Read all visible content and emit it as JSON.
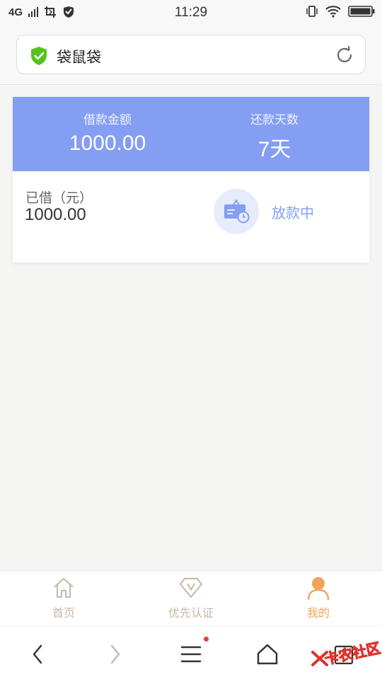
{
  "status_bar": {
    "network": "4G",
    "time": "11:29"
  },
  "url_bar": {
    "title": "袋鼠袋"
  },
  "loan_card": {
    "amount_label": "借款金额",
    "amount_value": "1000.00",
    "days_label": "还款天数",
    "days_value": "7天",
    "borrowed_label": "已借（元）",
    "borrowed_value": "1000.00",
    "status_text": "放款中"
  },
  "tabs": [
    {
      "label": "首页",
      "icon": "home-icon",
      "active": false
    },
    {
      "label": "优先认证",
      "icon": "diamond-v-icon",
      "active": false
    },
    {
      "label": "我的",
      "icon": "user-icon",
      "active": true
    }
  ],
  "browser_bar": {
    "tab_count": "1"
  },
  "watermark": {
    "text": "卡农社区"
  },
  "colors": {
    "accent_blue": "#849ef3",
    "active_orange": "#f4a25a",
    "inactive_tab": "#c7b7a8",
    "shield_green": "#52c41a"
  }
}
